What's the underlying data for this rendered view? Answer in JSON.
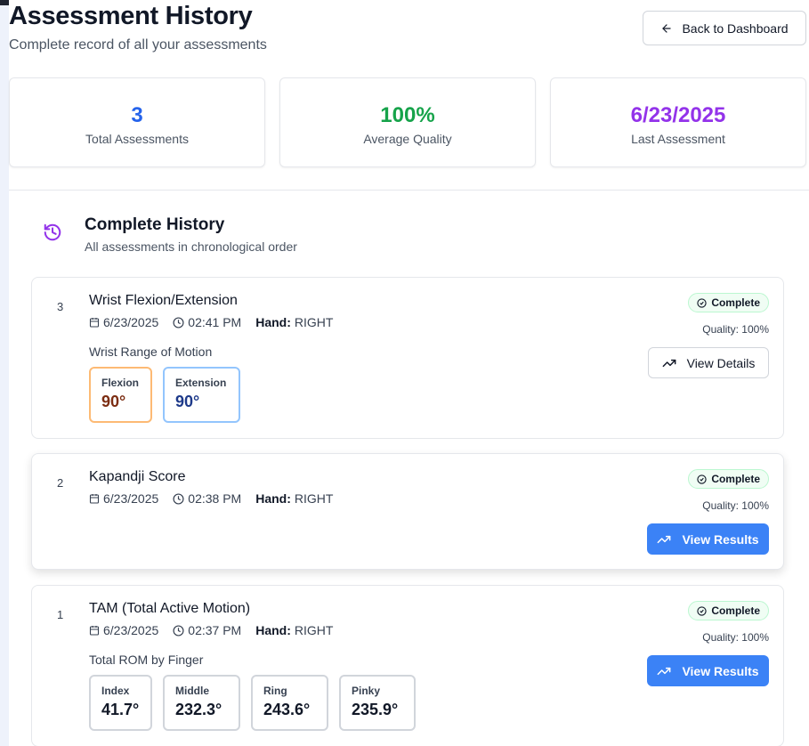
{
  "header": {
    "title": "Assessment History",
    "subtitle": "Complete record of all your assessments",
    "back_label": "Back to Dashboard"
  },
  "stats": [
    {
      "value": "3",
      "label": "Total Assessments",
      "color": "#2563eb"
    },
    {
      "value": "100%",
      "label": "Average Quality",
      "color": "#16a34a"
    },
    {
      "value": "6/23/2025",
      "label": "Last Assessment",
      "color": "#9333ea"
    }
  ],
  "history": {
    "title": "Complete History",
    "subtitle": "All assessments in chronological order",
    "icon": "history-icon",
    "assessments": [
      {
        "number": "3",
        "name": "Wrist Flexion/Extension",
        "date": "6/23/2025",
        "time": "02:41 PM",
        "hand_label": "Hand:",
        "hand": "RIGHT",
        "status": "Complete",
        "quality": "Quality: 100%",
        "action": "View Details",
        "section_label": "Wrist Range of Motion",
        "metrics": [
          {
            "label": "Flexion",
            "value": "90°",
            "border": "#fdba74",
            "color": "#7c2d12"
          },
          {
            "label": "Extension",
            "value": "90°",
            "border": "#93c5fd",
            "color": "#1e3a8a"
          }
        ]
      },
      {
        "number": "2",
        "name": "Kapandji Score",
        "date": "6/23/2025",
        "time": "02:38 PM",
        "hand_label": "Hand:",
        "hand": "RIGHT",
        "status": "Complete",
        "quality": "Quality: 100%",
        "action": "View Results"
      },
      {
        "number": "1",
        "name": "TAM (Total Active Motion)",
        "date": "6/23/2025",
        "time": "02:37 PM",
        "hand_label": "Hand:",
        "hand": "RIGHT",
        "status": "Complete",
        "quality": "Quality: 100%",
        "action": "View Results",
        "section_label": "Total ROM by Finger",
        "metrics": [
          {
            "label": "Index",
            "value": "41.7°"
          },
          {
            "label": "Middle",
            "value": "232.3°"
          },
          {
            "label": "Ring",
            "value": "243.6°"
          },
          {
            "label": "Pinky",
            "value": "235.9°"
          }
        ]
      }
    ]
  },
  "colors": {
    "accent": "#3b82f6",
    "history_icon": "#9333ea",
    "badge_border": "#bbf7d0"
  }
}
